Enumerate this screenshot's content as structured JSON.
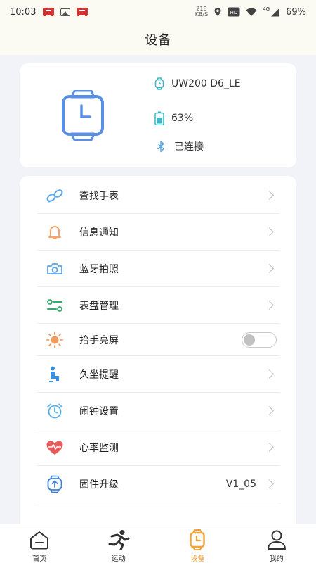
{
  "status_bar": {
    "time": "10:03",
    "speed_value": "218",
    "speed_unit": "KB/S",
    "network": "4G",
    "battery": "69%"
  },
  "page": {
    "title": "设备"
  },
  "device": {
    "name": "UW200 D6_LE",
    "battery": "63%",
    "connection_status": "已连接"
  },
  "menu": {
    "items": [
      {
        "label": "查找手表",
        "icon": "link-icon",
        "color": "#5aa6e8"
      },
      {
        "label": "信息通知",
        "icon": "bell-icon",
        "color": "#f39a5a"
      },
      {
        "label": "蓝牙拍照",
        "icon": "camera-icon",
        "color": "#5aa6e8"
      },
      {
        "label": "表盘管理",
        "icon": "sliders-icon",
        "color": "#2eae6a"
      },
      {
        "label": "抬手亮屏",
        "icon": "sun-icon",
        "color": "#f39a5a",
        "toggle": false
      },
      {
        "label": "久坐提醒",
        "icon": "sitting-icon",
        "color": "#3a8ee0"
      },
      {
        "label": "闹钟设置",
        "icon": "alarm-icon",
        "color": "#5ab0e8"
      },
      {
        "label": "心率监测",
        "icon": "heart-rate-icon",
        "color": "#e95b5b"
      },
      {
        "label": "固件升级",
        "icon": "upgrade-icon",
        "color": "#3a7fd8",
        "value": "V1_05"
      }
    ]
  },
  "tabs": [
    {
      "label": "首页",
      "icon": "home-icon",
      "active": false
    },
    {
      "label": "运动",
      "icon": "run-icon",
      "active": false
    },
    {
      "label": "设备",
      "icon": "watch-icon",
      "active": true
    },
    {
      "label": "我的",
      "icon": "user-icon",
      "active": false
    }
  ],
  "colors": {
    "accent": "#f3a33a",
    "watch_blue": "#5a8fe8",
    "background": "#f1f3f8"
  }
}
